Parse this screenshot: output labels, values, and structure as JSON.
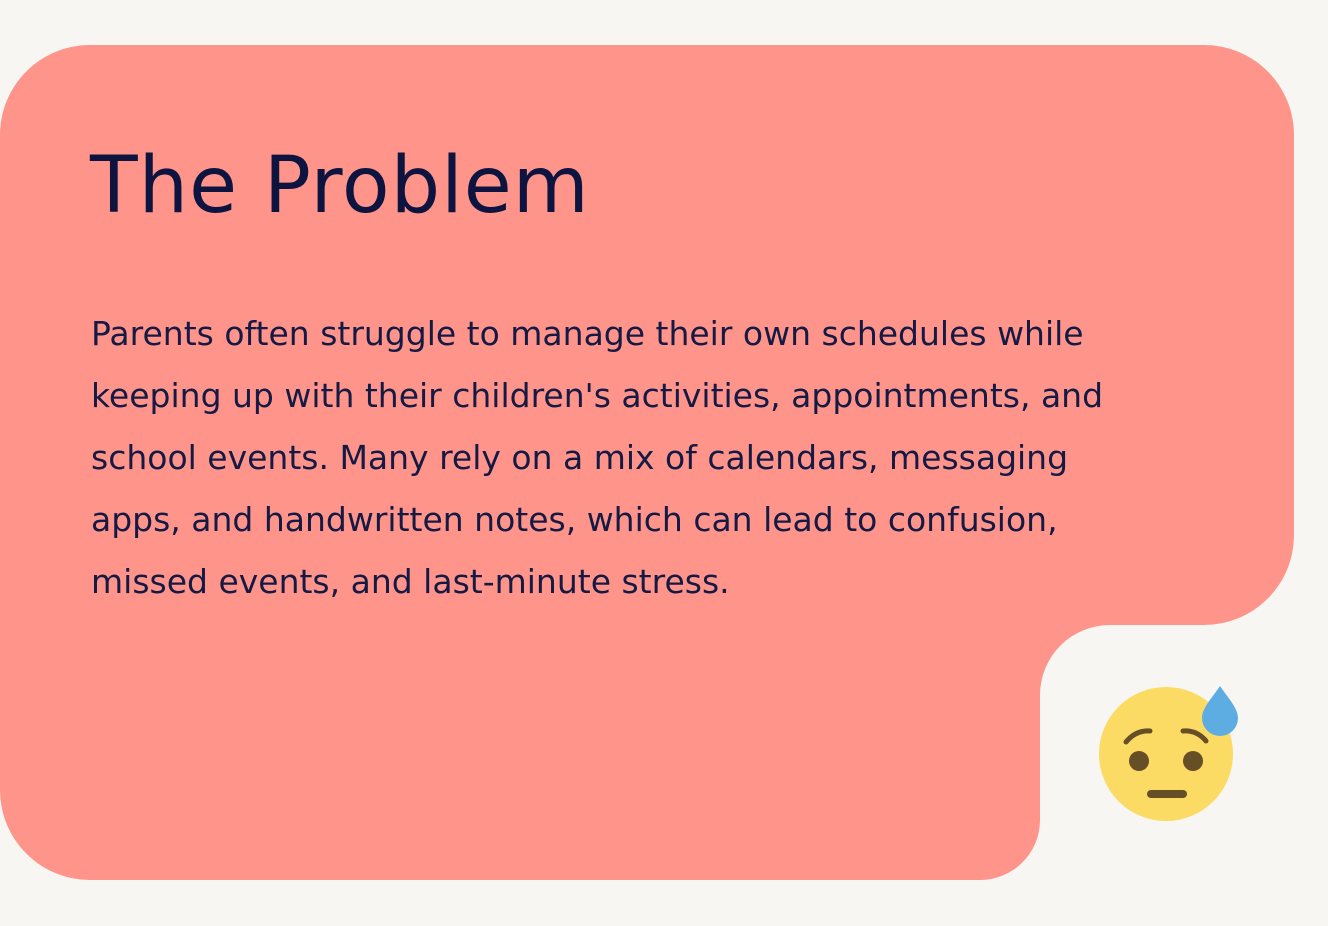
{
  "problem_card": {
    "title": "The Problem",
    "body_lines": [
      "Parents often struggle to manage their own schedules while",
      "keeping up with their children's activities, appointments, and",
      "school events. Many rely on a mix of calendars, messaging",
      "apps, and handwritten notes, which can lead to confusion,",
      "missed events, and last-minute stress."
    ],
    "emoji": "anxious-face-with-sweat-icon"
  },
  "colors": {
    "background": "#f8f6f3",
    "card": "#ff958a",
    "text": "#0e1440",
    "emoji_face": "#fbdb63",
    "emoji_features": "#664e27",
    "sweat_drop": "#5dade2"
  }
}
